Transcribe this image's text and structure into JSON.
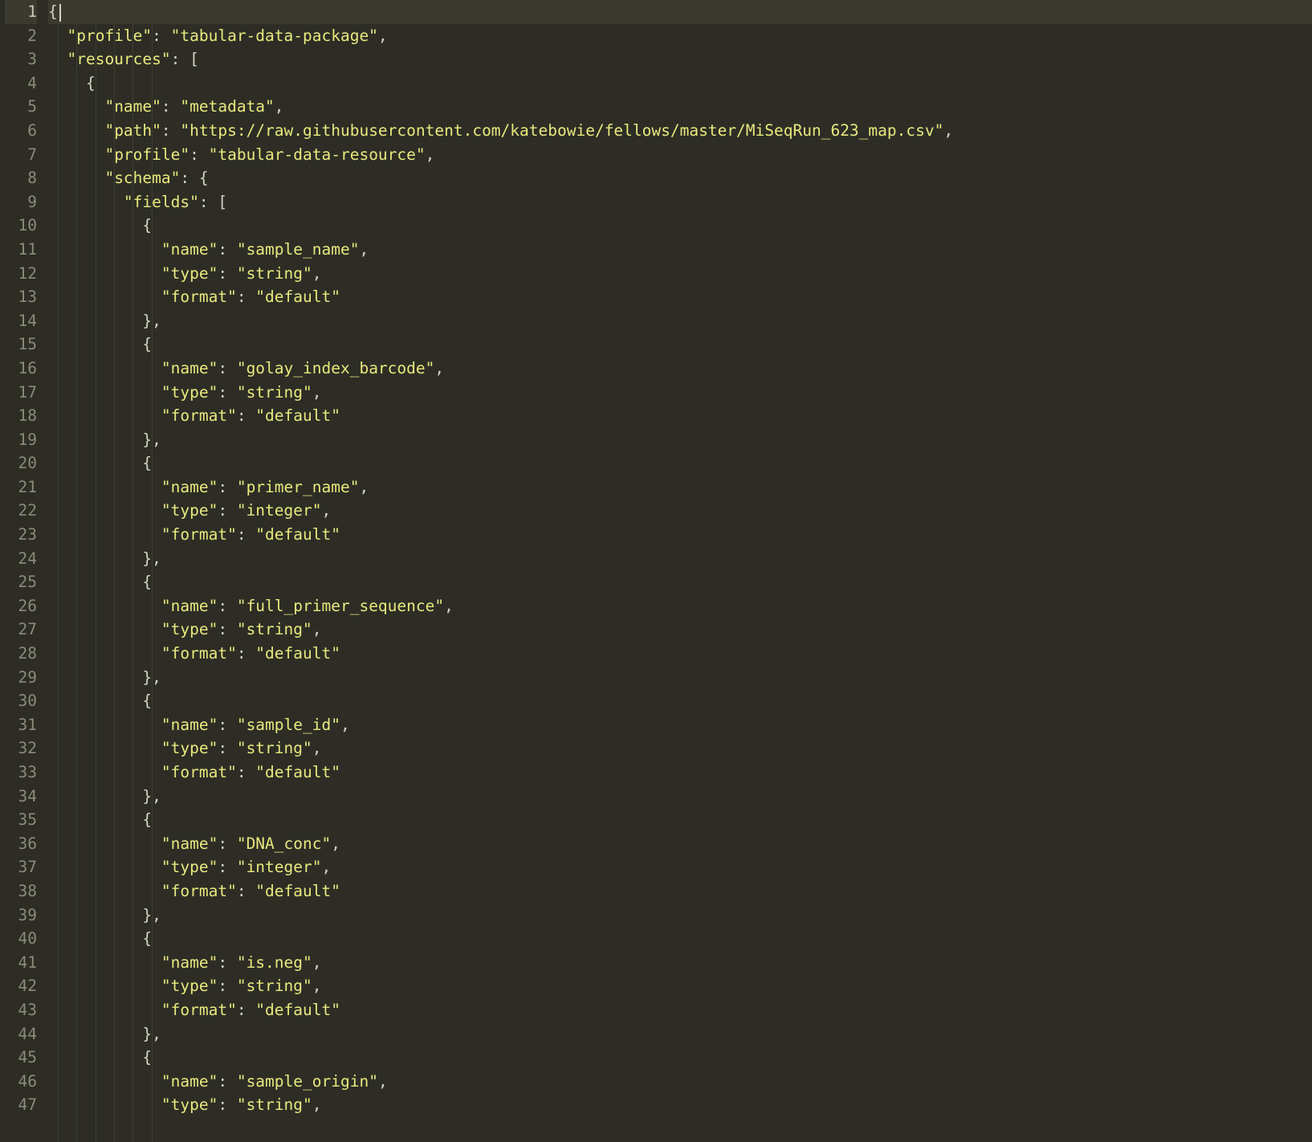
{
  "colors": {
    "bg": "#2d2d26",
    "string": "#e8e87e",
    "text": "#d4d4c4",
    "gutter": "#8b8b7a"
  },
  "active_line": 1,
  "lines": [
    {
      "n": 1,
      "indent": 0,
      "tokens": [
        [
          "p",
          "{"
        ]
      ]
    },
    {
      "n": 2,
      "indent": 1,
      "tokens": [
        [
          "s",
          "\"profile\""
        ],
        [
          "p",
          ": "
        ],
        [
          "s",
          "\"tabular-data-package\""
        ],
        [
          "p",
          ","
        ]
      ]
    },
    {
      "n": 3,
      "indent": 1,
      "tokens": [
        [
          "s",
          "\"resources\""
        ],
        [
          "p",
          ": ["
        ]
      ]
    },
    {
      "n": 4,
      "indent": 2,
      "tokens": [
        [
          "p",
          "{"
        ]
      ]
    },
    {
      "n": 5,
      "indent": 3,
      "tokens": [
        [
          "s",
          "\"name\""
        ],
        [
          "p",
          ": "
        ],
        [
          "s",
          "\"metadata\""
        ],
        [
          "p",
          ","
        ]
      ]
    },
    {
      "n": 6,
      "indent": 3,
      "tokens": [
        [
          "s",
          "\"path\""
        ],
        [
          "p",
          ": "
        ],
        [
          "s",
          "\"https://raw.githubusercontent.com/katebowie/fellows/master/MiSeqRun_623_map.csv\""
        ],
        [
          "p",
          ","
        ]
      ]
    },
    {
      "n": 7,
      "indent": 3,
      "tokens": [
        [
          "s",
          "\"profile\""
        ],
        [
          "p",
          ": "
        ],
        [
          "s",
          "\"tabular-data-resource\""
        ],
        [
          "p",
          ","
        ]
      ]
    },
    {
      "n": 8,
      "indent": 3,
      "tokens": [
        [
          "s",
          "\"schema\""
        ],
        [
          "p",
          ": {"
        ]
      ]
    },
    {
      "n": 9,
      "indent": 4,
      "tokens": [
        [
          "s",
          "\"fields\""
        ],
        [
          "p",
          ": ["
        ]
      ]
    },
    {
      "n": 10,
      "indent": 5,
      "tokens": [
        [
          "p",
          "{"
        ]
      ]
    },
    {
      "n": 11,
      "indent": 6,
      "tokens": [
        [
          "s",
          "\"name\""
        ],
        [
          "p",
          ": "
        ],
        [
          "s",
          "\"sample_name\""
        ],
        [
          "p",
          ","
        ]
      ]
    },
    {
      "n": 12,
      "indent": 6,
      "tokens": [
        [
          "s",
          "\"type\""
        ],
        [
          "p",
          ": "
        ],
        [
          "s",
          "\"string\""
        ],
        [
          "p",
          ","
        ]
      ]
    },
    {
      "n": 13,
      "indent": 6,
      "tokens": [
        [
          "s",
          "\"format\""
        ],
        [
          "p",
          ": "
        ],
        [
          "s",
          "\"default\""
        ]
      ]
    },
    {
      "n": 14,
      "indent": 5,
      "tokens": [
        [
          "p",
          "},"
        ]
      ]
    },
    {
      "n": 15,
      "indent": 5,
      "tokens": [
        [
          "p",
          "{"
        ]
      ]
    },
    {
      "n": 16,
      "indent": 6,
      "tokens": [
        [
          "s",
          "\"name\""
        ],
        [
          "p",
          ": "
        ],
        [
          "s",
          "\"golay_index_barcode\""
        ],
        [
          "p",
          ","
        ]
      ]
    },
    {
      "n": 17,
      "indent": 6,
      "tokens": [
        [
          "s",
          "\"type\""
        ],
        [
          "p",
          ": "
        ],
        [
          "s",
          "\"string\""
        ],
        [
          "p",
          ","
        ]
      ]
    },
    {
      "n": 18,
      "indent": 6,
      "tokens": [
        [
          "s",
          "\"format\""
        ],
        [
          "p",
          ": "
        ],
        [
          "s",
          "\"default\""
        ]
      ]
    },
    {
      "n": 19,
      "indent": 5,
      "tokens": [
        [
          "p",
          "},"
        ]
      ]
    },
    {
      "n": 20,
      "indent": 5,
      "tokens": [
        [
          "p",
          "{"
        ]
      ]
    },
    {
      "n": 21,
      "indent": 6,
      "tokens": [
        [
          "s",
          "\"name\""
        ],
        [
          "p",
          ": "
        ],
        [
          "s",
          "\"primer_name\""
        ],
        [
          "p",
          ","
        ]
      ]
    },
    {
      "n": 22,
      "indent": 6,
      "tokens": [
        [
          "s",
          "\"type\""
        ],
        [
          "p",
          ": "
        ],
        [
          "s",
          "\"integer\""
        ],
        [
          "p",
          ","
        ]
      ]
    },
    {
      "n": 23,
      "indent": 6,
      "tokens": [
        [
          "s",
          "\"format\""
        ],
        [
          "p",
          ": "
        ],
        [
          "s",
          "\"default\""
        ]
      ]
    },
    {
      "n": 24,
      "indent": 5,
      "tokens": [
        [
          "p",
          "},"
        ]
      ]
    },
    {
      "n": 25,
      "indent": 5,
      "tokens": [
        [
          "p",
          "{"
        ]
      ]
    },
    {
      "n": 26,
      "indent": 6,
      "tokens": [
        [
          "s",
          "\"name\""
        ],
        [
          "p",
          ": "
        ],
        [
          "s",
          "\"full_primer_sequence\""
        ],
        [
          "p",
          ","
        ]
      ]
    },
    {
      "n": 27,
      "indent": 6,
      "tokens": [
        [
          "s",
          "\"type\""
        ],
        [
          "p",
          ": "
        ],
        [
          "s",
          "\"string\""
        ],
        [
          "p",
          ","
        ]
      ]
    },
    {
      "n": 28,
      "indent": 6,
      "tokens": [
        [
          "s",
          "\"format\""
        ],
        [
          "p",
          ": "
        ],
        [
          "s",
          "\"default\""
        ]
      ]
    },
    {
      "n": 29,
      "indent": 5,
      "tokens": [
        [
          "p",
          "},"
        ]
      ]
    },
    {
      "n": 30,
      "indent": 5,
      "tokens": [
        [
          "p",
          "{"
        ]
      ]
    },
    {
      "n": 31,
      "indent": 6,
      "tokens": [
        [
          "s",
          "\"name\""
        ],
        [
          "p",
          ": "
        ],
        [
          "s",
          "\"sample_id\""
        ],
        [
          "p",
          ","
        ]
      ]
    },
    {
      "n": 32,
      "indent": 6,
      "tokens": [
        [
          "s",
          "\"type\""
        ],
        [
          "p",
          ": "
        ],
        [
          "s",
          "\"string\""
        ],
        [
          "p",
          ","
        ]
      ]
    },
    {
      "n": 33,
      "indent": 6,
      "tokens": [
        [
          "s",
          "\"format\""
        ],
        [
          "p",
          ": "
        ],
        [
          "s",
          "\"default\""
        ]
      ]
    },
    {
      "n": 34,
      "indent": 5,
      "tokens": [
        [
          "p",
          "},"
        ]
      ]
    },
    {
      "n": 35,
      "indent": 5,
      "tokens": [
        [
          "p",
          "{"
        ]
      ]
    },
    {
      "n": 36,
      "indent": 6,
      "tokens": [
        [
          "s",
          "\"name\""
        ],
        [
          "p",
          ": "
        ],
        [
          "s",
          "\"DNA_conc\""
        ],
        [
          "p",
          ","
        ]
      ]
    },
    {
      "n": 37,
      "indent": 6,
      "tokens": [
        [
          "s",
          "\"type\""
        ],
        [
          "p",
          ": "
        ],
        [
          "s",
          "\"integer\""
        ],
        [
          "p",
          ","
        ]
      ]
    },
    {
      "n": 38,
      "indent": 6,
      "tokens": [
        [
          "s",
          "\"format\""
        ],
        [
          "p",
          ": "
        ],
        [
          "s",
          "\"default\""
        ]
      ]
    },
    {
      "n": 39,
      "indent": 5,
      "tokens": [
        [
          "p",
          "},"
        ]
      ]
    },
    {
      "n": 40,
      "indent": 5,
      "tokens": [
        [
          "p",
          "{"
        ]
      ]
    },
    {
      "n": 41,
      "indent": 6,
      "tokens": [
        [
          "s",
          "\"name\""
        ],
        [
          "p",
          ": "
        ],
        [
          "s",
          "\"is.neg\""
        ],
        [
          "p",
          ","
        ]
      ]
    },
    {
      "n": 42,
      "indent": 6,
      "tokens": [
        [
          "s",
          "\"type\""
        ],
        [
          "p",
          ": "
        ],
        [
          "s",
          "\"string\""
        ],
        [
          "p",
          ","
        ]
      ]
    },
    {
      "n": 43,
      "indent": 6,
      "tokens": [
        [
          "s",
          "\"format\""
        ],
        [
          "p",
          ": "
        ],
        [
          "s",
          "\"default\""
        ]
      ]
    },
    {
      "n": 44,
      "indent": 5,
      "tokens": [
        [
          "p",
          "},"
        ]
      ]
    },
    {
      "n": 45,
      "indent": 5,
      "tokens": [
        [
          "p",
          "{"
        ]
      ]
    },
    {
      "n": 46,
      "indent": 6,
      "tokens": [
        [
          "s",
          "\"name\""
        ],
        [
          "p",
          ": "
        ],
        [
          "s",
          "\"sample_origin\""
        ],
        [
          "p",
          ","
        ]
      ]
    },
    {
      "n": 47,
      "indent": 6,
      "tokens": [
        [
          "s",
          "\"type\""
        ],
        [
          "p",
          ": "
        ],
        [
          "s",
          "\"string\""
        ],
        [
          "p",
          ","
        ]
      ]
    }
  ],
  "indent_unit": "  ",
  "guide_positions_ch": [
    1,
    3,
    5,
    7,
    9,
    11
  ]
}
